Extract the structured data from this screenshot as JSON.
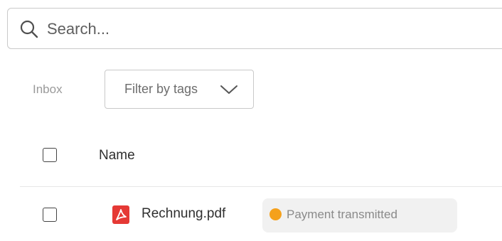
{
  "search": {
    "placeholder": "Search...",
    "value": "",
    "icon": "search-icon"
  },
  "filters": {
    "inbox_label": "Inbox",
    "tag_filter_label": "Filter by tags",
    "tag_filter_icon": "chevron-down-icon"
  },
  "table": {
    "columns": [
      "Name"
    ],
    "rows": [
      {
        "file_name": "Rechnung.pdf",
        "file_icon": "pdf-icon",
        "status": "Payment transmitted",
        "status_color": "#f5a11c",
        "checked": false
      }
    ]
  },
  "colors": {
    "pdf_red": "#e53935",
    "status_badge_bg": "#f1f1f1"
  }
}
